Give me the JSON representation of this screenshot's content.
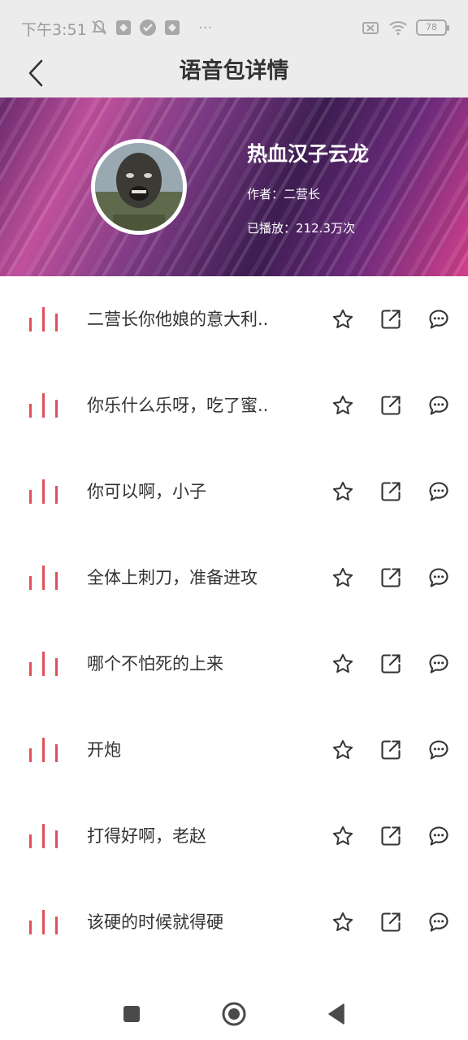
{
  "status_bar": {
    "time": "下午3:51",
    "more": "···",
    "battery": "78"
  },
  "header": {
    "title": "语音包详情"
  },
  "banner": {
    "name": "热血汉子云龙",
    "author": "作者：二营长",
    "plays": "已播放：212.3万次"
  },
  "items": [
    {
      "title": "二营长你他娘的意大利.."
    },
    {
      "title": "你乐什么乐呀，吃了蜜.."
    },
    {
      "title": "你可以啊，小子"
    },
    {
      "title": "全体上刺刀，准备进攻"
    },
    {
      "title": "哪个不怕死的上来"
    },
    {
      "title": "开炮"
    },
    {
      "title": "打得好啊，老赵"
    },
    {
      "title": "该硬的时候就得硬"
    }
  ],
  "icons": {
    "back": "chevron-left-icon",
    "wave": "sound-wave-icon",
    "star": "star-icon",
    "share": "share-icon",
    "comment": "comment-icon",
    "nav_recent": "square-icon",
    "nav_home": "circle-icon",
    "nav_back": "triangle-back-icon"
  },
  "colors": {
    "accent": "#e0505a",
    "banner": "#7c3a84",
    "header_bg": "#ececec"
  }
}
